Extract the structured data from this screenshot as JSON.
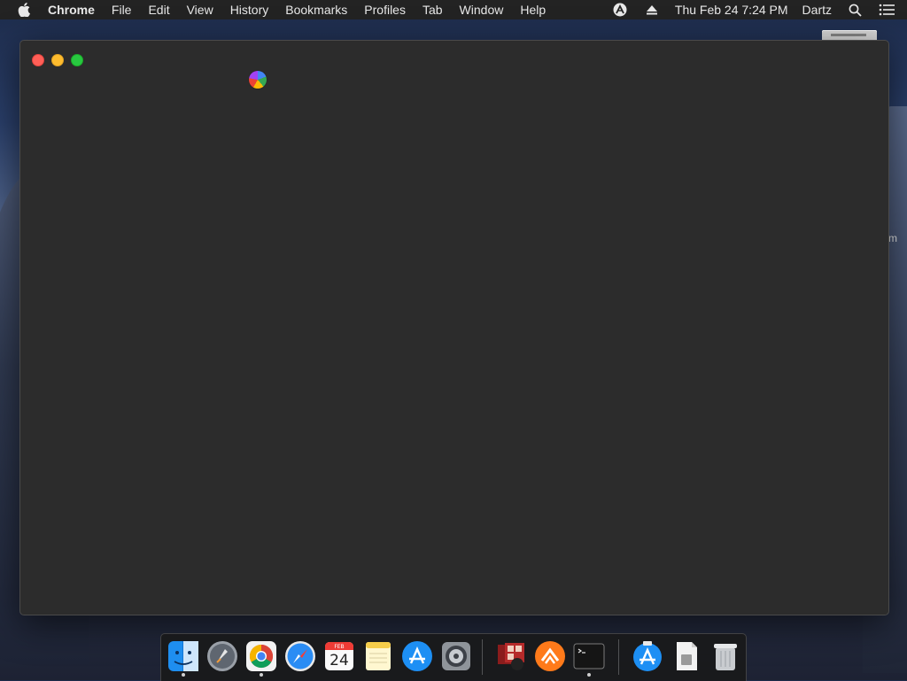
{
  "menubar": {
    "app_name": "Chrome",
    "items": [
      "File",
      "Edit",
      "View",
      "History",
      "Bookmarks",
      "Profiles",
      "Tab",
      "Window",
      "Help"
    ],
    "clock": "Thu Feb 24  7:24 PM",
    "user": "Dartz"
  },
  "desktop": {
    "fragment_text": "m"
  },
  "dock": {
    "calendar_month": "FEB",
    "calendar_day": "24",
    "items": [
      "finder-icon",
      "launchpad-icon",
      "chrome-icon",
      "safari-icon",
      "calendar-icon",
      "notes-icon",
      "app-store-icon",
      "system-preferences-icon",
      "photo-booth-icon",
      "sublime-merge-icon",
      "terminal-icon",
      "app-store-downloads-icon",
      "document-icon",
      "trash-icon"
    ]
  },
  "colors": {
    "menubar_bg": "#232323",
    "window_bg": "#2c2c2c",
    "close": "#ff5f57",
    "minimize": "#febc2e",
    "maximize": "#28c840"
  }
}
